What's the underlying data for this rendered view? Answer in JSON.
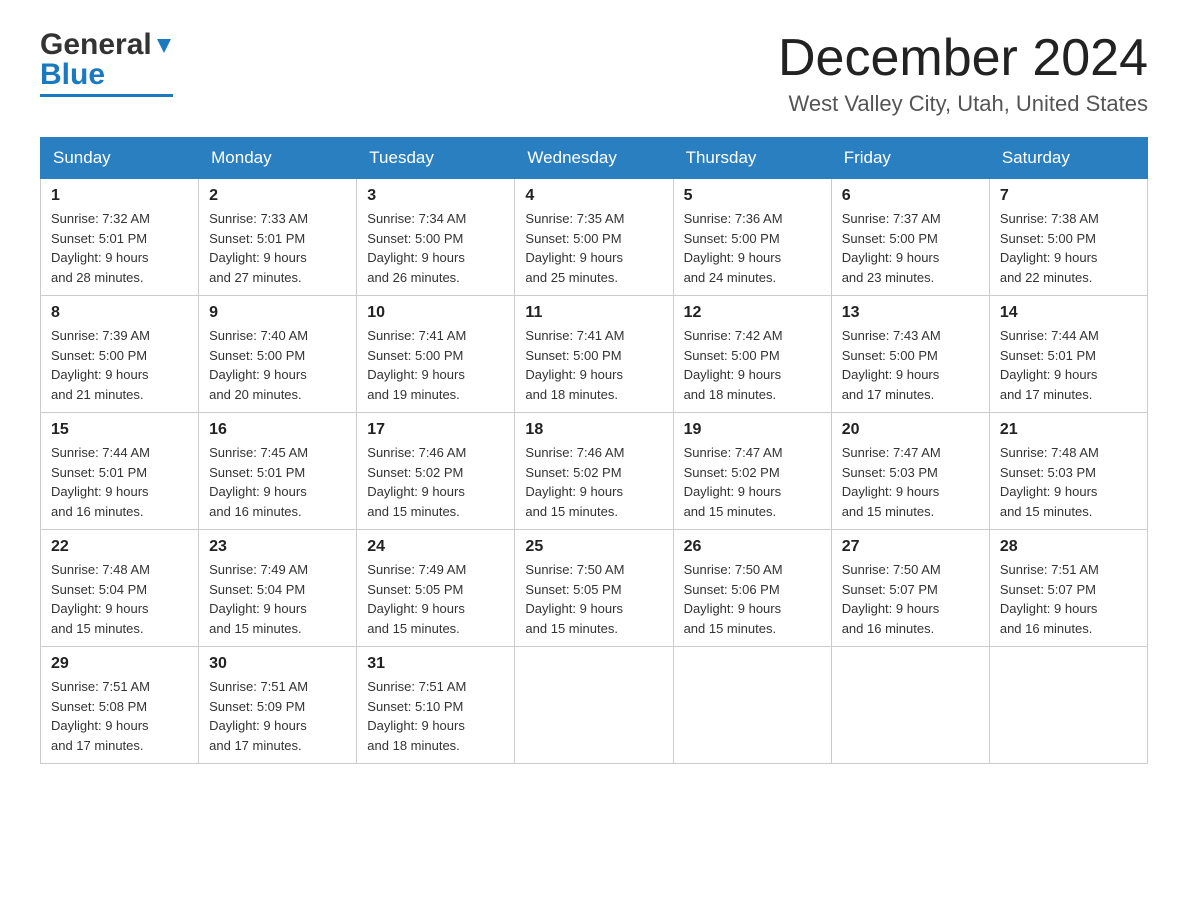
{
  "header": {
    "logo_general": "General",
    "logo_blue": "Blue",
    "title": "December 2024",
    "location": "West Valley City, Utah, United States"
  },
  "days_of_week": [
    "Sunday",
    "Monday",
    "Tuesday",
    "Wednesday",
    "Thursday",
    "Friday",
    "Saturday"
  ],
  "weeks": [
    [
      {
        "day": "1",
        "sunrise": "7:32 AM",
        "sunset": "5:01 PM",
        "daylight": "9 hours and 28 minutes."
      },
      {
        "day": "2",
        "sunrise": "7:33 AM",
        "sunset": "5:01 PM",
        "daylight": "9 hours and 27 minutes."
      },
      {
        "day": "3",
        "sunrise": "7:34 AM",
        "sunset": "5:00 PM",
        "daylight": "9 hours and 26 minutes."
      },
      {
        "day": "4",
        "sunrise": "7:35 AM",
        "sunset": "5:00 PM",
        "daylight": "9 hours and 25 minutes."
      },
      {
        "day": "5",
        "sunrise": "7:36 AM",
        "sunset": "5:00 PM",
        "daylight": "9 hours and 24 minutes."
      },
      {
        "day": "6",
        "sunrise": "7:37 AM",
        "sunset": "5:00 PM",
        "daylight": "9 hours and 23 minutes."
      },
      {
        "day": "7",
        "sunrise": "7:38 AM",
        "sunset": "5:00 PM",
        "daylight": "9 hours and 22 minutes."
      }
    ],
    [
      {
        "day": "8",
        "sunrise": "7:39 AM",
        "sunset": "5:00 PM",
        "daylight": "9 hours and 21 minutes."
      },
      {
        "day": "9",
        "sunrise": "7:40 AM",
        "sunset": "5:00 PM",
        "daylight": "9 hours and 20 minutes."
      },
      {
        "day": "10",
        "sunrise": "7:41 AM",
        "sunset": "5:00 PM",
        "daylight": "9 hours and 19 minutes."
      },
      {
        "day": "11",
        "sunrise": "7:41 AM",
        "sunset": "5:00 PM",
        "daylight": "9 hours and 18 minutes."
      },
      {
        "day": "12",
        "sunrise": "7:42 AM",
        "sunset": "5:00 PM",
        "daylight": "9 hours and 18 minutes."
      },
      {
        "day": "13",
        "sunrise": "7:43 AM",
        "sunset": "5:00 PM",
        "daylight": "9 hours and 17 minutes."
      },
      {
        "day": "14",
        "sunrise": "7:44 AM",
        "sunset": "5:01 PM",
        "daylight": "9 hours and 17 minutes."
      }
    ],
    [
      {
        "day": "15",
        "sunrise": "7:44 AM",
        "sunset": "5:01 PM",
        "daylight": "9 hours and 16 minutes."
      },
      {
        "day": "16",
        "sunrise": "7:45 AM",
        "sunset": "5:01 PM",
        "daylight": "9 hours and 16 minutes."
      },
      {
        "day": "17",
        "sunrise": "7:46 AM",
        "sunset": "5:02 PM",
        "daylight": "9 hours and 15 minutes."
      },
      {
        "day": "18",
        "sunrise": "7:46 AM",
        "sunset": "5:02 PM",
        "daylight": "9 hours and 15 minutes."
      },
      {
        "day": "19",
        "sunrise": "7:47 AM",
        "sunset": "5:02 PM",
        "daylight": "9 hours and 15 minutes."
      },
      {
        "day": "20",
        "sunrise": "7:47 AM",
        "sunset": "5:03 PM",
        "daylight": "9 hours and 15 minutes."
      },
      {
        "day": "21",
        "sunrise": "7:48 AM",
        "sunset": "5:03 PM",
        "daylight": "9 hours and 15 minutes."
      }
    ],
    [
      {
        "day": "22",
        "sunrise": "7:48 AM",
        "sunset": "5:04 PM",
        "daylight": "9 hours and 15 minutes."
      },
      {
        "day": "23",
        "sunrise": "7:49 AM",
        "sunset": "5:04 PM",
        "daylight": "9 hours and 15 minutes."
      },
      {
        "day": "24",
        "sunrise": "7:49 AM",
        "sunset": "5:05 PM",
        "daylight": "9 hours and 15 minutes."
      },
      {
        "day": "25",
        "sunrise": "7:50 AM",
        "sunset": "5:05 PM",
        "daylight": "9 hours and 15 minutes."
      },
      {
        "day": "26",
        "sunrise": "7:50 AM",
        "sunset": "5:06 PM",
        "daylight": "9 hours and 15 minutes."
      },
      {
        "day": "27",
        "sunrise": "7:50 AM",
        "sunset": "5:07 PM",
        "daylight": "9 hours and 16 minutes."
      },
      {
        "day": "28",
        "sunrise": "7:51 AM",
        "sunset": "5:07 PM",
        "daylight": "9 hours and 16 minutes."
      }
    ],
    [
      {
        "day": "29",
        "sunrise": "7:51 AM",
        "sunset": "5:08 PM",
        "daylight": "9 hours and 17 minutes."
      },
      {
        "day": "30",
        "sunrise": "7:51 AM",
        "sunset": "5:09 PM",
        "daylight": "9 hours and 17 minutes."
      },
      {
        "day": "31",
        "sunrise": "7:51 AM",
        "sunset": "5:10 PM",
        "daylight": "9 hours and 18 minutes."
      },
      null,
      null,
      null,
      null
    ]
  ],
  "labels": {
    "sunrise": "Sunrise:",
    "sunset": "Sunset:",
    "daylight": "Daylight:"
  }
}
